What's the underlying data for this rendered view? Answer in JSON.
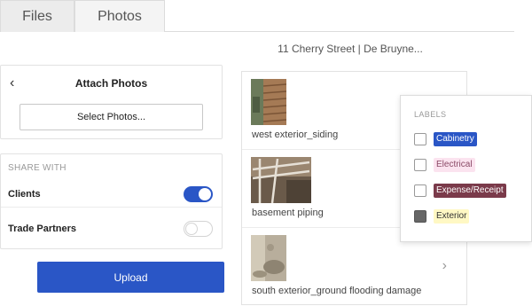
{
  "tabs": [
    {
      "label": "Files"
    },
    {
      "label": "Photos"
    }
  ],
  "project_title": "11 Cherry Street | De Bruyne...",
  "attach": {
    "back_glyph": "‹",
    "title": "Attach Photos",
    "select_button": "Select Photos..."
  },
  "share": {
    "header": "SHARE WITH",
    "clients": {
      "label": "Clients",
      "enabled": true
    },
    "trade_partners": {
      "label": "Trade Partners",
      "enabled": false
    }
  },
  "upload_button": "Upload",
  "photos": [
    {
      "caption": "west exterior_siding"
    },
    {
      "caption": "basement piping"
    },
    {
      "caption": "south exterior_ground flooding damage"
    }
  ],
  "chevron_glyph": "›",
  "labels": {
    "header": "LABELS",
    "items": [
      {
        "name": "Cabinetry",
        "checked": false,
        "bg": "#2a56c6",
        "fg": "#ffffff"
      },
      {
        "name": "Electrical",
        "checked": false,
        "bg": "#fbe3ef",
        "fg": "#8a4a66"
      },
      {
        "name": "Expense/Receipt",
        "checked": false,
        "bg": "#7a3a4a",
        "fg": "#ffffff"
      },
      {
        "name": "Exterior",
        "checked": true,
        "bg": "#fff8c4",
        "fg": "#333333"
      }
    ]
  },
  "colors": {
    "accent": "#2a56c6",
    "toggle_off": "#ffffff"
  }
}
